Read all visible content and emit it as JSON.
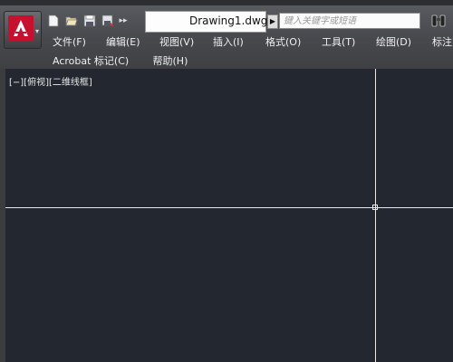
{
  "window": {
    "title": "Drawing1.dwg"
  },
  "search": {
    "placeholder": "键入关键字或短语"
  },
  "quick_access": {
    "icons": [
      "new-icon",
      "open-icon",
      "save-icon",
      "save-as-icon",
      "more-icon"
    ],
    "more_label": "▸▸"
  },
  "menu": {
    "row1": [
      {
        "label": "文件(F)"
      },
      {
        "label": "编辑(E)"
      },
      {
        "label": "视图(V)"
      },
      {
        "label": "插入(I)"
      },
      {
        "label": "格式(O)"
      },
      {
        "label": "工具(T)"
      },
      {
        "label": "绘图(D)"
      },
      {
        "label": "标注"
      }
    ],
    "row2": [
      {
        "label": "Acrobat 标记(C)"
      },
      {
        "label": "帮助(H)"
      }
    ]
  },
  "viewport": {
    "label": "[−][俯视][二维线框]"
  },
  "colors": {
    "canvas": "#232830",
    "crosshair": "#e8e8e8",
    "logo_red": "#c8102e"
  }
}
